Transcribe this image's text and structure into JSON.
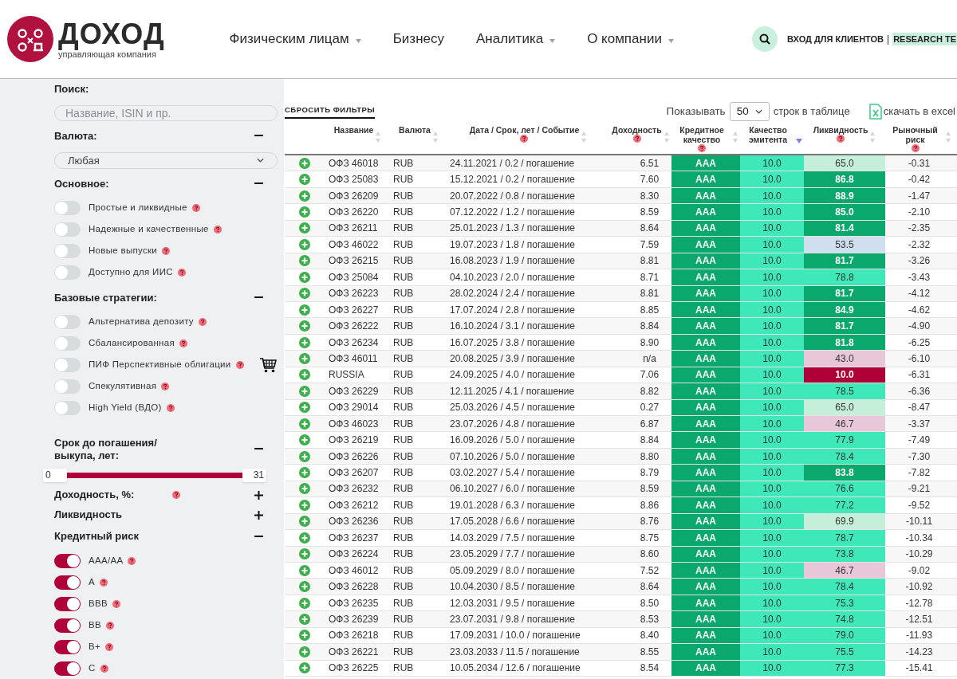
{
  "header": {
    "logo": {
      "title": "ДОХОД",
      "subtitle": "управляющая компания"
    },
    "nav": [
      {
        "label": "Физическим лицам",
        "dropdown": true
      },
      {
        "label": "Бизнесу",
        "dropdown": false
      },
      {
        "label": "Аналитика",
        "dropdown": true
      },
      {
        "label": "О компании",
        "dropdown": true
      }
    ],
    "login": "ВХОД ДЛЯ КЛИЕНТОВ",
    "separator": "|",
    "research": "RESEARCH TE"
  },
  "sidebar": {
    "search_label": "Поиск:",
    "search": {
      "placeholder": "Название, ISIN и пр."
    },
    "sections": [
      {
        "kind": "select",
        "title": "Валюта:",
        "expanded": true,
        "value": "Любая"
      },
      {
        "kind": "toggles",
        "title": "Основное:",
        "expanded": true,
        "items": [
          {
            "label": "Простые и ликвидные",
            "on": false,
            "help": true,
            "cart": false
          },
          {
            "label": "Надежные и качественные",
            "on": false,
            "help": true,
            "cart": false
          },
          {
            "label": "Новые выпуски",
            "on": false,
            "help": true,
            "cart": false
          },
          {
            "label": "Доступно для ИИС",
            "on": false,
            "help": true,
            "cart": false
          }
        ]
      },
      {
        "kind": "toggles",
        "title": "Базовые стратегии:",
        "expanded": true,
        "items": [
          {
            "label": "Альтернатива депозиту",
            "on": false,
            "help": true,
            "cart": false
          },
          {
            "label": "Сбалансированная",
            "on": false,
            "help": true,
            "cart": false
          },
          {
            "label": "ПИФ Перспективные облигации",
            "on": false,
            "help": true,
            "cart": true
          },
          {
            "label": "Спекулятивная",
            "on": false,
            "help": true,
            "cart": false
          },
          {
            "label": "High Yield (ВДО)",
            "on": false,
            "help": true,
            "cart": false
          }
        ]
      },
      {
        "kind": "range",
        "title": "Срок до погашения/ выкупа, лет:",
        "expanded": true,
        "min": "0",
        "max": "31",
        "level": 1
      },
      {
        "kind": "header",
        "title": "Доходность, %:",
        "expanded": false,
        "help": true
      },
      {
        "kind": "header",
        "title": "Ликвидность",
        "expanded": false,
        "help": false
      },
      {
        "kind": "toggles",
        "title": "Кредитный риск",
        "expanded": true,
        "items": [
          {
            "label": "AAA/AA",
            "on": true,
            "help": true,
            "cart": false
          },
          {
            "label": "A",
            "on": true,
            "help": true,
            "cart": false
          },
          {
            "label": "BBB",
            "on": true,
            "help": true,
            "cart": false
          },
          {
            "label": "BB",
            "on": true,
            "help": true,
            "cart": false
          },
          {
            "label": "B+",
            "on": true,
            "help": true,
            "cart": false
          },
          {
            "label": "C",
            "on": true,
            "help": true,
            "cart": false
          }
        ]
      }
    ]
  },
  "toolbar": {
    "reset": "СБРОСИТЬ ФИЛЬТРЫ",
    "show_label": "Показывать",
    "page_size": "50",
    "rows_label": "строк в таблице",
    "excel": "скачать в excel"
  },
  "table": {
    "columns": [
      {
        "label": "Название",
        "help": false,
        "sorted": false
      },
      {
        "label": "Валюта",
        "help": false,
        "sorted": false
      },
      {
        "label": "Дата / Срок, лет / Событие",
        "help": true,
        "sorted": false
      },
      {
        "label": "Доходность",
        "help": true,
        "sorted": false
      },
      {
        "label": "Кредитное качество",
        "help": true,
        "sorted": false
      },
      {
        "label": "Качество эмитента",
        "help": false,
        "sorted": true
      },
      {
        "label": "Ликвидность",
        "help": true,
        "sorted": false
      },
      {
        "label": "Рыночный риск",
        "help": true,
        "sorted": false
      }
    ],
    "rows": [
      {
        "name": "ОФЗ 46018",
        "currency": "RUB",
        "date": "24.11.2021 / 0.2 / погашение",
        "yield": "6.51",
        "credit": "AAA",
        "issuer": "10.0",
        "liquidity": "65.0",
        "color": "#c6efd9",
        "risk": "-0.31"
      },
      {
        "name": "ОФЗ 25083",
        "currency": "RUB",
        "date": "15.12.2021 / 0.2 / погашение",
        "yield": "7.60",
        "credit": "AAA",
        "issuer": "10.0",
        "liquidity": "86.8",
        "color": "#0aa86c",
        "risk": "-0.42"
      },
      {
        "name": "ОФЗ 26209",
        "currency": "RUB",
        "date": "20.07.2022 / 0.8 / погашение",
        "yield": "8.30",
        "credit": "AAA",
        "issuer": "10.0",
        "liquidity": "88.9",
        "color": "#0aa86c",
        "risk": "-1.47"
      },
      {
        "name": "ОФЗ 26220",
        "currency": "RUB",
        "date": "07.12.2022 / 1.2 / погашение",
        "yield": "8.59",
        "credit": "AAA",
        "issuer": "10.0",
        "liquidity": "85.0",
        "color": "#0aa86c",
        "risk": "-2.10"
      },
      {
        "name": "ОФЗ 26211",
        "currency": "RUB",
        "date": "25.01.2023 / 1.3 / погашение",
        "yield": "8.64",
        "credit": "AAA",
        "issuer": "10.0",
        "liquidity": "81.4",
        "color": "#0aa86c",
        "risk": "-2.35"
      },
      {
        "name": "ОФЗ 46022",
        "currency": "RUB",
        "date": "19.07.2023 / 1.8 / погашение",
        "yield": "7.59",
        "credit": "AAA",
        "issuer": "10.0",
        "liquidity": "53.5",
        "color": "#cfdff0",
        "risk": "-2.32"
      },
      {
        "name": "ОФЗ 26215",
        "currency": "RUB",
        "date": "16.08.2023 / 1.9 / погашение",
        "yield": "8.81",
        "credit": "AAA",
        "issuer": "10.0",
        "liquidity": "81.7",
        "color": "#0aa86c",
        "risk": "-3.26"
      },
      {
        "name": "ОФЗ 25084",
        "currency": "RUB",
        "date": "04.10.2023 / 2.0 / погашение",
        "yield": "8.71",
        "credit": "AAA",
        "issuer": "10.0",
        "liquidity": "78.8",
        "color": "#3ee8b8",
        "risk": "-3.43"
      },
      {
        "name": "ОФЗ 26223",
        "currency": "RUB",
        "date": "28.02.2024 / 2.4 / погашение",
        "yield": "8.81",
        "credit": "AAA",
        "issuer": "10.0",
        "liquidity": "81.7",
        "color": "#0aa86c",
        "risk": "-4.12"
      },
      {
        "name": "ОФЗ 26227",
        "currency": "RUB",
        "date": "17.07.2024 / 2.8 / погашение",
        "yield": "8.85",
        "credit": "AAA",
        "issuer": "10.0",
        "liquidity": "84.9",
        "color": "#0aa86c",
        "risk": "-4.62"
      },
      {
        "name": "ОФЗ 26222",
        "currency": "RUB",
        "date": "16.10.2024 / 3.1 / погашение",
        "yield": "8.84",
        "credit": "AAA",
        "issuer": "10.0",
        "liquidity": "81.7",
        "color": "#0aa86c",
        "risk": "-4.90"
      },
      {
        "name": "ОФЗ 26234",
        "currency": "RUB",
        "date": "16.07.2025 / 3.8 / погашение",
        "yield": "8.90",
        "credit": "AAA",
        "issuer": "10.0",
        "liquidity": "81.8",
        "color": "#0aa86c",
        "risk": "-6.25"
      },
      {
        "name": "ОФЗ 46011",
        "currency": "RUB",
        "date": "20.08.2025 / 3.9 / погашение",
        "yield": "n/a",
        "credit": "AAA",
        "issuer": "10.0",
        "liquidity": "43.0",
        "color": "#e8c8d8",
        "risk": "-6.10"
      },
      {
        "name": "RUSSIA",
        "currency": "RUB",
        "date": "24.09.2025 / 4.0 / погашение",
        "yield": "7.06",
        "credit": "AAA",
        "issuer": "10.0",
        "liquidity": "10.0",
        "color": "#b00038",
        "risk": "-6.31"
      },
      {
        "name": "ОФЗ 26229",
        "currency": "RUB",
        "date": "12.11.2025 / 4.1 / погашение",
        "yield": "8.82",
        "credit": "AAA",
        "issuer": "10.0",
        "liquidity": "78.5",
        "color": "#3ee8b8",
        "risk": "-6.36"
      },
      {
        "name": "ОФЗ 29014",
        "currency": "RUB",
        "date": "25.03.2026 / 4.5 / погашение",
        "yield": "0.27",
        "credit": "AAA",
        "issuer": "10.0",
        "liquidity": "65.0",
        "color": "#c6efd9",
        "risk": "-8.47"
      },
      {
        "name": "ОФЗ 46023",
        "currency": "RUB",
        "date": "23.07.2026 / 4.8 / погашение",
        "yield": "6.87",
        "credit": "AAA",
        "issuer": "10.0",
        "liquidity": "46.7",
        "color": "#e8c8d8",
        "risk": "-3.37"
      },
      {
        "name": "ОФЗ 26219",
        "currency": "RUB",
        "date": "16.09.2026 / 5.0 / погашение",
        "yield": "8.84",
        "credit": "AAA",
        "issuer": "10.0",
        "liquidity": "77.9",
        "color": "#3ee8b8",
        "risk": "-7.49"
      },
      {
        "name": "ОФЗ 26226",
        "currency": "RUB",
        "date": "07.10.2026 / 5.0 / погашение",
        "yield": "8.80",
        "credit": "AAA",
        "issuer": "10.0",
        "liquidity": "78.4",
        "color": "#3ee8b8",
        "risk": "-7.30"
      },
      {
        "name": "ОФЗ 26207",
        "currency": "RUB",
        "date": "03.02.2027 / 5.4 / погашение",
        "yield": "8.79",
        "credit": "AAA",
        "issuer": "10.0",
        "liquidity": "83.8",
        "color": "#0aa86c",
        "risk": "-7.82"
      },
      {
        "name": "ОФЗ 26232",
        "currency": "RUB",
        "date": "06.10.2027 / 6.0 / погашение",
        "yield": "8.59",
        "credit": "AAA",
        "issuer": "10.0",
        "liquidity": "76.6",
        "color": "#3ee8b8",
        "risk": "-9.21"
      },
      {
        "name": "ОФЗ 26212",
        "currency": "RUB",
        "date": "19.01.2028 / 6.3 / погашение",
        "yield": "8.86",
        "credit": "AAA",
        "issuer": "10.0",
        "liquidity": "77.2",
        "color": "#3ee8b8",
        "risk": "-9.52"
      },
      {
        "name": "ОФЗ 26236",
        "currency": "RUB",
        "date": "17.05.2028 / 6.6 / погашение",
        "yield": "8.76",
        "credit": "AAA",
        "issuer": "10.0",
        "liquidity": "69.9",
        "color": "#c6efd9",
        "risk": "-10.11"
      },
      {
        "name": "ОФЗ 26237",
        "currency": "RUB",
        "date": "14.03.2029 / 7.5 / погашение",
        "yield": "8.75",
        "credit": "AAA",
        "issuer": "10.0",
        "liquidity": "78.7",
        "color": "#3ee8b8",
        "risk": "-10.34"
      },
      {
        "name": "ОФЗ 26224",
        "currency": "RUB",
        "date": "23.05.2029 / 7.7 / погашение",
        "yield": "8.60",
        "credit": "AAA",
        "issuer": "10.0",
        "liquidity": "73.8",
        "color": "#3ee8b8",
        "risk": "-10.29"
      },
      {
        "name": "ОФЗ 46012",
        "currency": "RUB",
        "date": "05.09.2029 / 8.0 / погашение",
        "yield": "7.52",
        "credit": "AAA",
        "issuer": "10.0",
        "liquidity": "46.7",
        "color": "#e8c8d8",
        "risk": "-9.02"
      },
      {
        "name": "ОФЗ 26228",
        "currency": "RUB",
        "date": "10.04.2030 / 8.5 / погашение",
        "yield": "8.64",
        "credit": "AAA",
        "issuer": "10.0",
        "liquidity": "78.4",
        "color": "#3ee8b8",
        "risk": "-10.92"
      },
      {
        "name": "ОФЗ 26235",
        "currency": "RUB",
        "date": "12.03.2031 / 9.5 / погашение",
        "yield": "8.50",
        "credit": "AAA",
        "issuer": "10.0",
        "liquidity": "75.3",
        "color": "#3ee8b8",
        "risk": "-12.78"
      },
      {
        "name": "ОФЗ 26239",
        "currency": "RUB",
        "date": "23.07.2031 / 9.8 / погашение",
        "yield": "8.53",
        "credit": "AAA",
        "issuer": "10.0",
        "liquidity": "74.8",
        "color": "#3ee8b8",
        "risk": "-12.51"
      },
      {
        "name": "ОФЗ 26218",
        "currency": "RUB",
        "date": "17.09.2031 / 10.0 / погашение",
        "yield": "8.40",
        "credit": "AAA",
        "issuer": "10.0",
        "liquidity": "79.0",
        "color": "#3ee8b8",
        "risk": "-11.93"
      },
      {
        "name": "ОФЗ 26221",
        "currency": "RUB",
        "date": "23.03.2033 / 11.5 / погашение",
        "yield": "8.55",
        "credit": "AAA",
        "issuer": "10.0",
        "liquidity": "75.5",
        "color": "#3ee8b8",
        "risk": "-14.23"
      },
      {
        "name": "ОФЗ 26225",
        "currency": "RUB",
        "date": "10.05.2034 / 12.6 / погашение",
        "yield": "8.54",
        "credit": "AAA",
        "issuer": "10.0",
        "liquidity": "77.3",
        "color": "#3ee8b8",
        "risk": "-15.41"
      }
    ]
  }
}
